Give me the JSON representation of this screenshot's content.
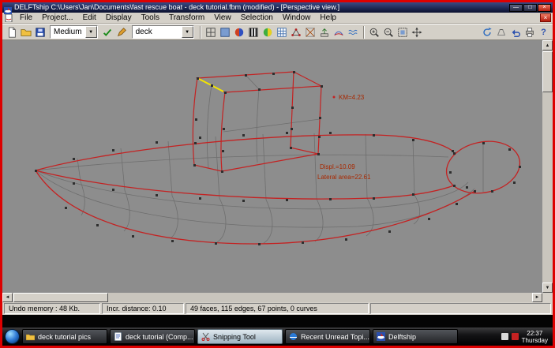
{
  "window": {
    "title": "DELFTship C:\\Users\\Jan\\Documents\\fast rescue boat - deck tutorial.fbm (modified) - [Perspective view.]"
  },
  "glyphs": {
    "minimize": "—",
    "maximize": "□",
    "close": "×",
    "dropdown": "▼",
    "scroll_up": "▲",
    "scroll_down": "▼",
    "scroll_left": "◄",
    "scroll_right": "►",
    "help": "?"
  },
  "menu": {
    "items": [
      "File",
      "Project...",
      "Edit",
      "Display",
      "Tools",
      "Transform",
      "View",
      "Selection",
      "Window",
      "Help"
    ]
  },
  "toolbar": {
    "precision_value": "Medium",
    "layer_value": "deck"
  },
  "viewport": {
    "annotations": {
      "km": "KM=4.23",
      "displacement": "Displ.=10.09",
      "lateral_area": "Lateral area=22.61"
    }
  },
  "statusbar": {
    "undo_memory": "Undo memory : 48 Kb.",
    "incr_distance": "Incr. distance: 0.10",
    "model_stats": "49 faces, 115 edges, 67 points, 0 curves"
  },
  "taskbar": {
    "buttons": [
      {
        "label": "deck tutorial pics"
      },
      {
        "label": "deck tutorial (Comp..."
      },
      {
        "label": "Snipping Tool"
      },
      {
        "label": "Recent Unread Topi..."
      },
      {
        "label": "Delftship"
      }
    ],
    "clock": {
      "time": "22:37",
      "day": "Thursday"
    }
  },
  "colors": {
    "edge_red": "#c42222",
    "highlight_yellow": "#f2e400",
    "annotation": "#a82800",
    "viewport_bg": "#8d8d8d"
  }
}
